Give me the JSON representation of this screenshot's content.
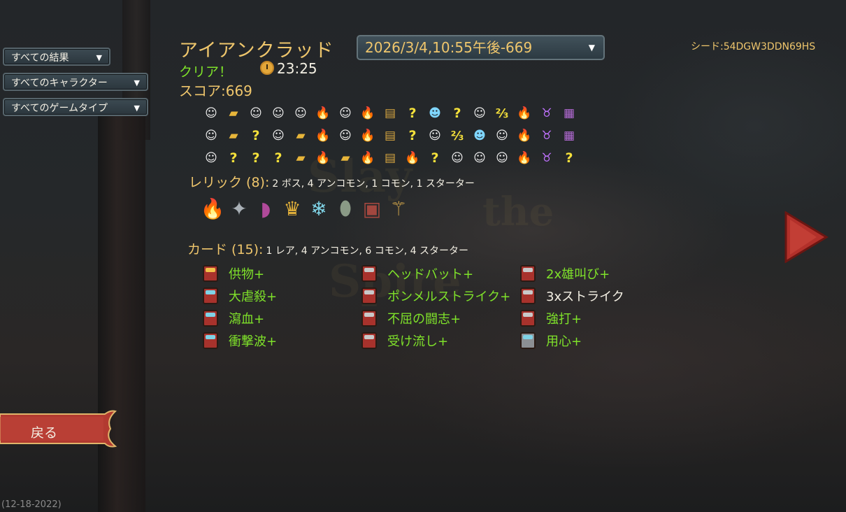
{
  "filters": [
    {
      "label": "すべての結果"
    },
    {
      "label": "すべてのキャラクター"
    },
    {
      "label": "すべてのゲームタイプ"
    }
  ],
  "run": {
    "character": "アイアンクラッド",
    "result": "クリア！",
    "time": "23:25",
    "score": "スコア:669",
    "selected_run": "2026/3/4,10:55午後-669",
    "seed": "シード:54DGW3DDN69HS"
  },
  "map": {
    "rows": [
      [
        "monster",
        "shop",
        "monster",
        "monster",
        "monster",
        "rest",
        "monster",
        "rest",
        "treasure",
        "question",
        "elite",
        "question",
        "monster",
        "special",
        "rest",
        "boss",
        "bosschest"
      ],
      [
        "monster",
        "shop",
        "question",
        "monster",
        "shop",
        "rest",
        "monster",
        "rest",
        "treasure",
        "question",
        "monster",
        "special",
        "elite",
        "monster",
        "rest",
        "boss",
        "bosschest"
      ],
      [
        "monster",
        "question",
        "question",
        "question",
        "shop",
        "rest",
        "shop",
        "rest",
        "treasure",
        "rest",
        "question",
        "monster",
        "monster",
        "monster",
        "rest",
        "boss",
        "question"
      ]
    ],
    "glyphs": {
      "monster": "☺",
      "shop": "▰",
      "question": "?",
      "rest": "🔥",
      "treasure": "▤",
      "elite": "☻",
      "boss": "♉",
      "bosschest": "▦",
      "special": "⅔"
    }
  },
  "relics": {
    "heading": "レリック (8):",
    "summary": "2 ボス, 4 アンコモン, 1 コモン, 1 スターター",
    "items": [
      {
        "icon": "burning-blood-icon",
        "glyph": "🔥",
        "color": "#e8502a"
      },
      {
        "icon": "shuriken-icon",
        "glyph": "✦",
        "color": "#a9b0b6"
      },
      {
        "icon": "ornamental-fan-icon",
        "glyph": "◗",
        "color": "#b04a9a"
      },
      {
        "icon": "crown-icon",
        "glyph": "♛",
        "color": "#e2b03a"
      },
      {
        "icon": "crystal-icon",
        "glyph": "❄",
        "color": "#7fd3e6"
      },
      {
        "icon": "egg-icon",
        "glyph": "⬮",
        "color": "#8a9a86"
      },
      {
        "icon": "runic-cube-icon",
        "glyph": "▣",
        "color": "#a2473f"
      },
      {
        "icon": "vajra-icon",
        "glyph": "⚚",
        "color": "#d1a54a"
      }
    ]
  },
  "cards": {
    "heading": "カード (15):",
    "summary": "1 レア, 4 アンコモン, 6 コモン, 4 スターター",
    "columns": [
      [
        {
          "name": "供物+",
          "upgraded": true,
          "type": "red rare"
        },
        {
          "name": "大虐殺+",
          "upgraded": true,
          "type": "red unc"
        },
        {
          "name": "瀉血+",
          "upgraded": true,
          "type": "red unc"
        },
        {
          "name": "衝撃波+",
          "upgraded": true,
          "type": "red unc"
        }
      ],
      [
        {
          "name": "ヘッドバット+",
          "upgraded": true,
          "type": "red com"
        },
        {
          "name": "ポンメルストライク+",
          "upgraded": true,
          "type": "red com"
        },
        {
          "name": "不屈の闘志+",
          "upgraded": true,
          "type": "red com"
        },
        {
          "name": "受け流し+",
          "upgraded": true,
          "type": "red com"
        }
      ],
      [
        {
          "name": "2x雄叫び+",
          "upgraded": true,
          "type": "red com"
        },
        {
          "name": "3xストライク",
          "upgraded": false,
          "type": "red com"
        },
        {
          "name": "強打+",
          "upgraded": true,
          "type": "red com"
        },
        {
          "name": "用心+",
          "upgraded": true,
          "type": "gray"
        }
      ]
    ]
  },
  "nav": {
    "back_label": "戻る"
  },
  "version": "(12-18-2022)"
}
